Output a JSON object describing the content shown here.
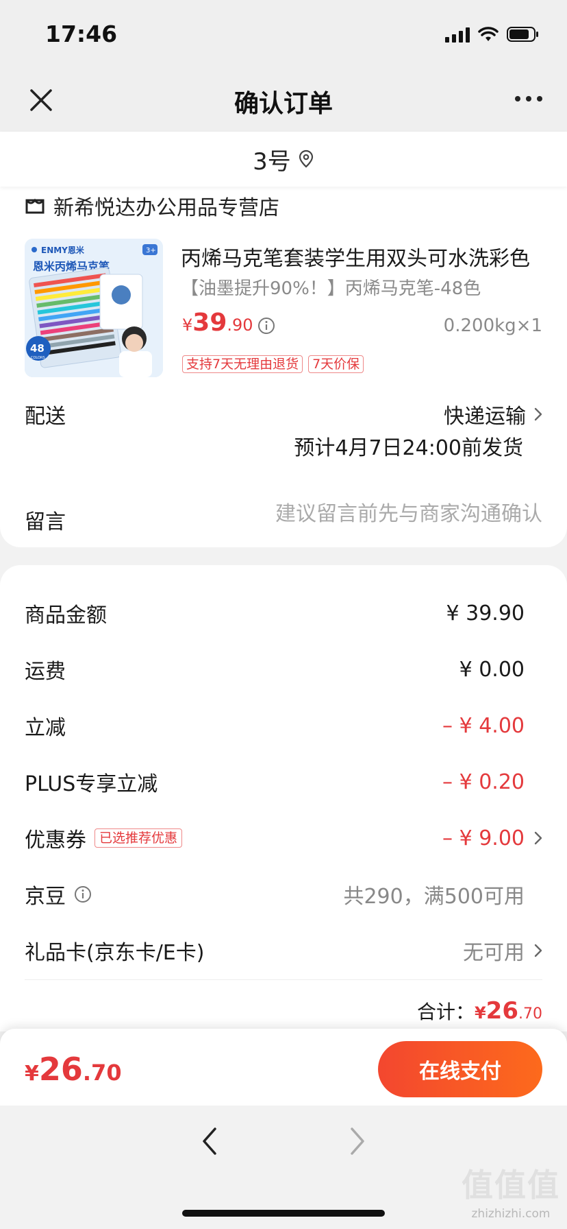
{
  "status_bar": {
    "time": "17:46"
  },
  "nav": {
    "title": "确认订单"
  },
  "address": {
    "text": "3号"
  },
  "shop": {
    "name": "新希悦达办公用品专营店"
  },
  "product": {
    "title": "丙烯马克笔套装学生用双头可水洗彩色",
    "spec": "【油墨提升90%！】丙烯马克笔-48色",
    "price_yen": "¥",
    "price_int": "39",
    "price_dec": ".90",
    "weight": "0.200kg×1",
    "tags": [
      "支持7天无理由退货",
      "7天价保"
    ],
    "image_brand": "ENMY恩米",
    "image_title": "恩米丙烯马克笔",
    "image_count": "48",
    "image_count_sub": "COLORS",
    "image_age": "3+"
  },
  "delivery": {
    "label": "配送",
    "method": "快递运输",
    "eta": "预计4月7日24:00前发货"
  },
  "message": {
    "label": "留言",
    "placeholder": "建议留言前先与商家沟通确认"
  },
  "price_rows": {
    "goods": {
      "label": "商品金额",
      "value": "¥ 39.90"
    },
    "shipping": {
      "label": "运费",
      "value": "¥ 0.00"
    },
    "discount": {
      "label": "立减",
      "value": "– ¥ 4.00"
    },
    "plus": {
      "label": "PLUS专享立减",
      "value": "– ¥ 0.20"
    },
    "coupon": {
      "label": "优惠券",
      "badge": "已选推荐优惠",
      "value": "– ¥ 9.00"
    },
    "jingdou": {
      "label": "京豆",
      "value": "共290，满500可用"
    },
    "giftcard": {
      "label": "礼品卡(京东卡/E卡)",
      "value": "无可用"
    }
  },
  "subtotal": {
    "label": "合计：",
    "yen": "¥",
    "int": "26",
    "dec": ".70"
  },
  "pay": {
    "yen": "¥",
    "int": "26",
    "dec": ".70",
    "button": "在线支付"
  },
  "watermark": {
    "big": "值值值",
    "small": "zhizhizhi.com"
  },
  "colors": {
    "accent_red": "#e4393c",
    "pay_gradient_start": "#f3472f",
    "pay_gradient_end": "#fd6a1c"
  }
}
